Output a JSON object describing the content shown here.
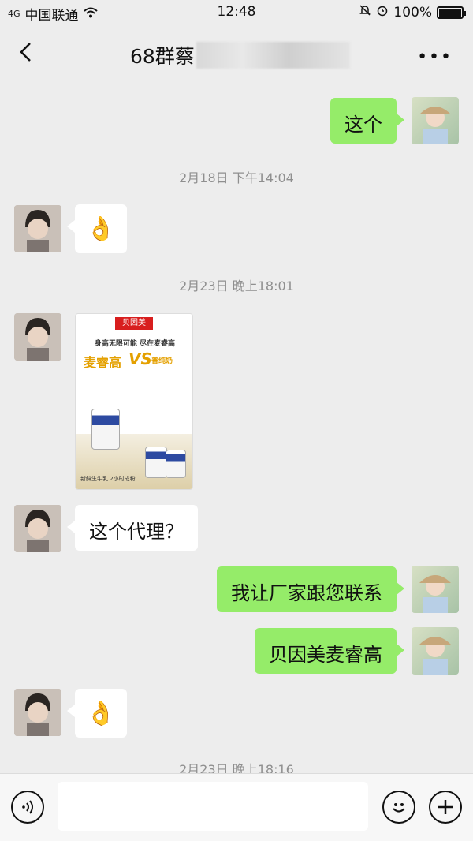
{
  "status": {
    "carrier": "中国联通",
    "signal": "4G",
    "time": "12:48",
    "battery": "100%"
  },
  "header": {
    "title": "68群蔡",
    "back_icon": "chevron-left-icon",
    "more_icon": "more-horizontal-icon"
  },
  "messages": [
    {
      "side": "right",
      "type": "text",
      "text": "这个"
    },
    {
      "type": "timestamp",
      "text": "2月18日 下午14:04"
    },
    {
      "side": "left",
      "type": "emoji",
      "text": "👌"
    },
    {
      "type": "timestamp",
      "text": "2月23日 晚上18:01"
    },
    {
      "side": "left",
      "type": "image"
    },
    {
      "side": "left",
      "type": "text",
      "text": "这个代理？"
    },
    {
      "side": "right",
      "type": "text",
      "text": "我让厂家跟您联系"
    },
    {
      "side": "right",
      "type": "text",
      "text": "贝因美麦睿高"
    },
    {
      "side": "left",
      "type": "emoji",
      "text": "👌"
    },
    {
      "type": "timestamp",
      "text": "2月23日 晚上18:16"
    }
  ],
  "image_card": {
    "brand": "贝因美",
    "slogan": "身高无限可能 尽在麦睿高",
    "title": "麦睿高",
    "vs": "VS",
    "subtitle": "普纯奶",
    "footer": "新鲜生牛乳   2小时成粉"
  },
  "inputbar": {
    "voice_icon": "voice-icon",
    "emoji_icon": "emoji-icon",
    "plus_icon": "plus-icon"
  }
}
